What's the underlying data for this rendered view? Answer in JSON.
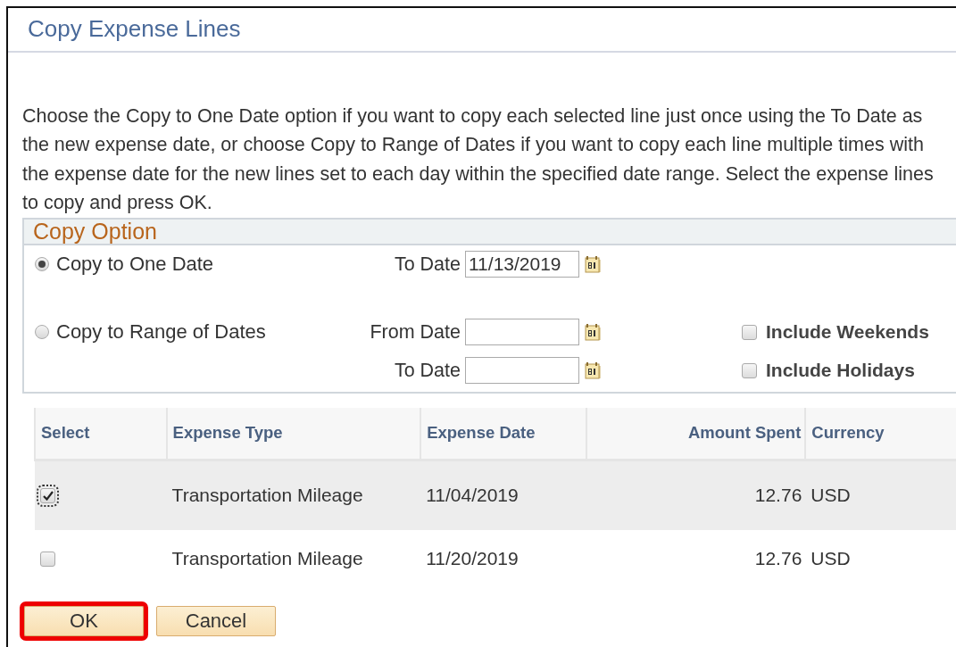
{
  "dialog": {
    "title": "Copy Expense Lines"
  },
  "instructions": "Choose the Copy to One Date option if you want to copy each selected line just once using the To Date as the new expense date, or choose Copy to Range of Dates if you want to copy each line multiple times with the expense date for the new lines set to each day within the specified date range. Select the expense lines to copy and press OK.",
  "copy_option": {
    "title": "Copy Option",
    "options": [
      {
        "label": "Copy to One Date",
        "selected": true,
        "dates": [
          {
            "label": "To Date",
            "value": "11/13/2019"
          }
        ]
      },
      {
        "label": "Copy to Range of Dates",
        "selected": false,
        "dates": [
          {
            "label": "From Date"
          },
          {
            "label": "To Date"
          }
        ],
        "checkboxes": [
          {
            "label": "Include Weekends",
            "checked": false
          },
          {
            "label": "Include Holidays",
            "checked": false
          }
        ]
      }
    ]
  },
  "table": {
    "columns": [
      "Select",
      "Expense Type",
      "Expense Date",
      "Amount Spent",
      "Currency"
    ],
    "rows": [
      {
        "checked": true,
        "selected": true,
        "expense_type": "Transportation Mileage",
        "expense_date": "11/04/2019",
        "amount": "12.76",
        "currency": "USD"
      },
      {
        "checked": false,
        "selected": false,
        "expense_type": "Transportation Mileage",
        "expense_date": "11/20/2019",
        "amount": "12.76",
        "currency": "USD"
      }
    ]
  },
  "buttons": [
    {
      "label": "OK",
      "highlighted": true
    },
    {
      "label": "Cancel",
      "highlighted": false
    }
  ]
}
